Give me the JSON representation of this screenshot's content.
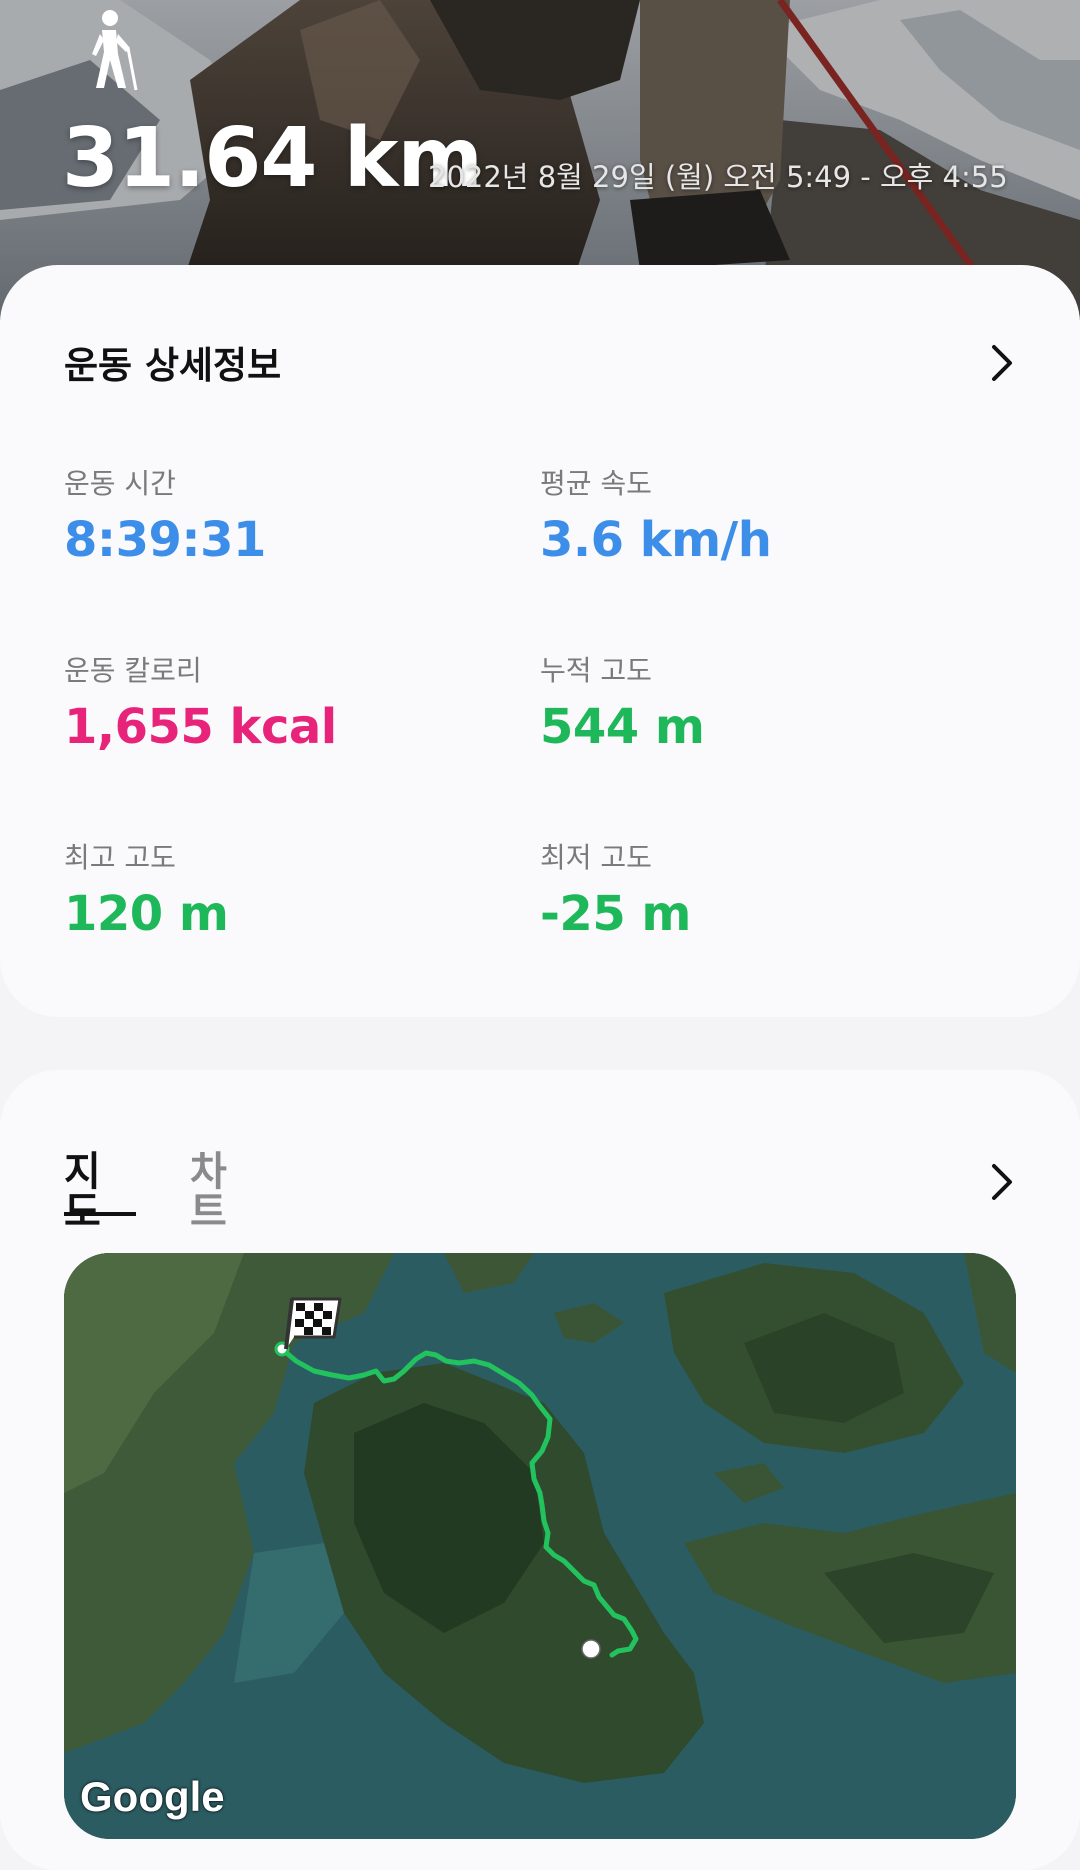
{
  "header": {
    "activity_icon": "hiking-person-icon",
    "distance": "31.64 km",
    "date_range": "2022년 8월 29일 (월) 오전 5:49 - 오후 4:55"
  },
  "details": {
    "title": "운동 상세정보",
    "chevron_icon": "chevron-right-icon",
    "stats": [
      {
        "label": "운동 시간",
        "value": "8:39:31",
        "color": "#3d8ee8"
      },
      {
        "label": "평균 속도",
        "value": "3.6 km/h",
        "color": "#3d8ee8"
      },
      {
        "label": "운동 칼로리",
        "value": "1,655 kcal",
        "color": "#e8247a"
      },
      {
        "label": "누적 고도",
        "value": "544 m",
        "color": "#1eb85a"
      },
      {
        "label": "최고 고도",
        "value": "120 m",
        "color": "#1eb85a"
      },
      {
        "label": "최저 고도",
        "value": "-25 m",
        "color": "#1eb85a"
      }
    ]
  },
  "map_card": {
    "tabs": [
      {
        "label": "지도",
        "active": true
      },
      {
        "label": "차트",
        "active": false
      }
    ],
    "chevron_icon": "chevron-right-icon",
    "map": {
      "attribution": "Google",
      "start_marker_icon": "checkered-flag-icon",
      "end_marker_icon": "end-point-dot-icon",
      "route_color": "#22c35e"
    }
  }
}
